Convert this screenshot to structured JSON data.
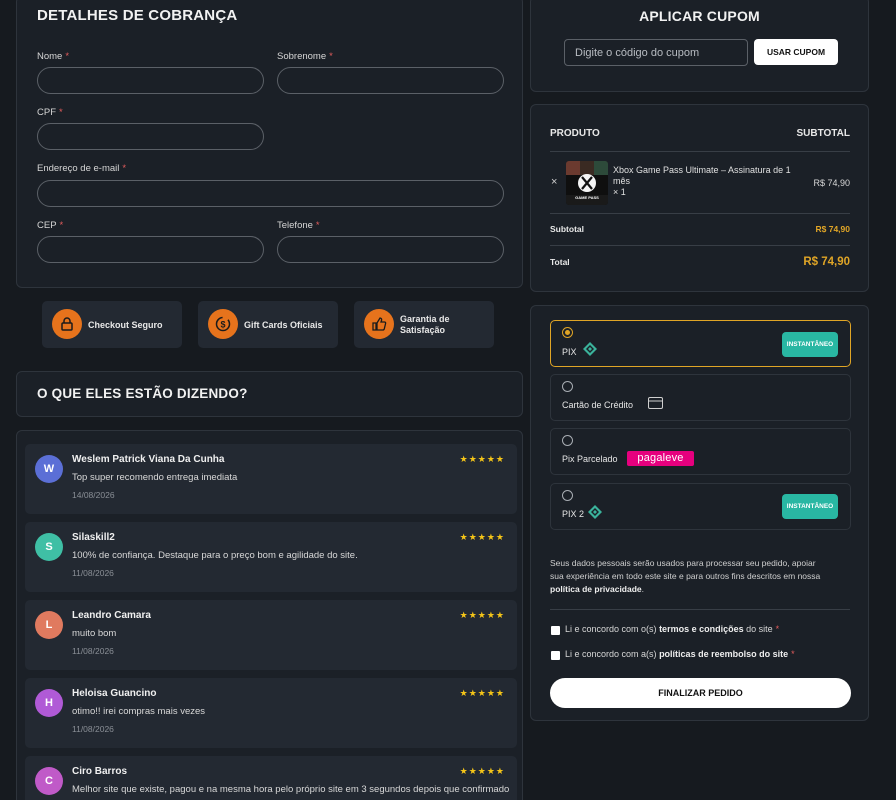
{
  "billing": {
    "title": "DETALHES DE COBRANÇA",
    "fields": {
      "first_name": "Nome",
      "last_name": "Sobrenome",
      "cpf": "CPF",
      "email": "Endereço de e-mail",
      "cep": "CEP",
      "phone": "Telefone"
    },
    "required_mark": "*"
  },
  "badges": [
    {
      "label": "Checkout Seguro",
      "icon": "lock-icon"
    },
    {
      "label": "Gift Cards Oficiais",
      "icon": "dollar-cycle-icon"
    },
    {
      "label_line1": "Garantia de",
      "label_line2": "Satisfação",
      "icon": "thumbs-up-icon"
    }
  ],
  "reviews": {
    "title": "O QUE ELES ESTÃO DIZENDO?",
    "stars": "★★★★★",
    "items": [
      {
        "initial": "W",
        "name": "Weslem Patrick Viana Da Cunha",
        "text": "Top super recomendo entrega imediata",
        "date": "14/08/2026",
        "color": "#5b6fd6"
      },
      {
        "initial": "S",
        "name": "Silaskill2",
        "text": "100% de confiança. Destaque para o preço bom e agilidade do site.",
        "date": "11/08/2026",
        "color": "#3fbfa5"
      },
      {
        "initial": "L",
        "name": "Leandro Camara",
        "text": "muito bom",
        "date": "11/08/2026",
        "color": "#e07a5f"
      },
      {
        "initial": "H",
        "name": "Heloisa Guancino",
        "text": "otimo!! irei compras mais vezes",
        "date": "11/08/2026",
        "color": "#b05ad6"
      },
      {
        "initial": "C",
        "name": "Ciro Barros",
        "text": "Melhor site que existe, pagou e na mesma hora pelo próprio site em 3 segundos depois que confirmado o",
        "date": "",
        "color": "#c05ac8"
      }
    ]
  },
  "coupon": {
    "title": "APLICAR CUPOM",
    "placeholder": "Digite o código do cupom",
    "button": "USAR CUPOM"
  },
  "order": {
    "col_product": "PRODUTO",
    "col_subtotal": "SUBTOTAL",
    "remove": "×",
    "product_line1": "Xbox Game Pass Ultimate – Assinatura de 1",
    "product_line2": "mês",
    "quantity": "× 1",
    "product_price": "R$ 74,90",
    "thumb_caption": "GAME PASS",
    "subtotal_label": "Subtotal",
    "subtotal_value": "R$ 74,90",
    "total_label": "Total",
    "total_value": "R$ 74,90"
  },
  "payment": {
    "options": [
      {
        "label": "PIX",
        "tag": "INSTANTÂNEO",
        "icon": "pix-icon"
      },
      {
        "label": "Cartão de Crédito",
        "icon": "credit-card-icon"
      },
      {
        "label": "Pix Parcelado",
        "logo": "pagaleve"
      },
      {
        "label": "PIX 2",
        "tag": "INSTANTÂNEO",
        "icon": "pix-icon"
      }
    ],
    "privacy_text_1": "Seus dados pessoais serão usados para processar seu pedido, apoiar",
    "privacy_text_2": "sua experiência em todo este site e para outros fins descritos em nossa",
    "privacy_link": "política de privacidade",
    "privacy_end": ".",
    "terms_prefix": "Li e concordo com o(s)",
    "terms_link": "termos e condições",
    "terms_suffix": "do site",
    "refund_prefix": "Li e concordo com a(s)",
    "refund_link": "políticas de reembolso do site",
    "finish_button": "FINALIZAR PEDIDO"
  },
  "colors": {
    "accent": "#e0a526",
    "instant": "#29b7a3",
    "badge_icon": "#e6731c"
  }
}
